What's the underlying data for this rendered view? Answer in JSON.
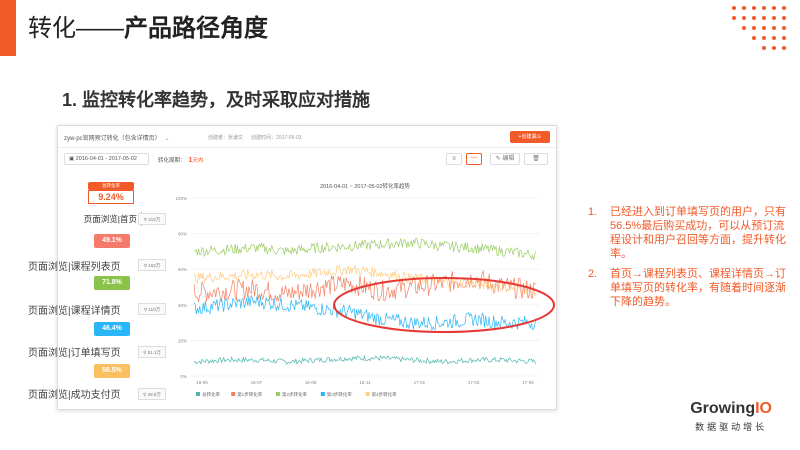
{
  "slide": {
    "title_light": "转化——",
    "title_bold": "产品路径角度",
    "subtitle": "1. 监控转化率趋势，及时采取应对措施",
    "accent_color": "#f15a29"
  },
  "report": {
    "name": "zyw-pc官网预订转化（包含详情页）",
    "creator": "创建者：张谦文",
    "created_at": "创建时间：2017-05-03",
    "new_button": "+创建漏斗",
    "date_range": "2016-04-01 - 2017-05-02",
    "period_label": "转化周期：",
    "period_value": "1",
    "period_unit": "天内",
    "edit_label": "编辑",
    "delete_label": "删除"
  },
  "funnel": {
    "total_tag": "总转化率",
    "total_value": "9.24%",
    "steps": [
      {
        "label": "页面浏览|首页",
        "count": "313万"
      },
      {
        "label": "页面浏览|课程列表页",
        "count": "153万"
      },
      {
        "label": "页面浏览|课程详情页",
        "count": "110万"
      },
      {
        "label": "页面浏览|订单填写页",
        "count": "51.1万"
      },
      {
        "label": "页面浏览|成功支付页",
        "count": "28.9万"
      }
    ],
    "rates": [
      {
        "value": "49.1%",
        "color": "#f47b6b"
      },
      {
        "value": "71.8%",
        "color": "#8bc34a"
      },
      {
        "value": "46.4%",
        "color": "#29b6f6"
      },
      {
        "value": "56.5%",
        "color": "#fbbf5f"
      }
    ]
  },
  "chart_data": {
    "type": "line",
    "title": "2016-04-01 ~ 2017-05-02转化率趋势",
    "x": [
      "16-05",
      "16-07",
      "16-09",
      "16-11",
      "17-01",
      "17-03",
      "17-05"
    ],
    "ylim": [
      0,
      100
    ],
    "yticks": [
      "100%",
      "80%",
      "60%",
      "40%",
      "20%",
      "0%"
    ],
    "series": [
      {
        "name": "总转化率",
        "color": "#4db6ac",
        "values": [
          8,
          9,
          9,
          8,
          9,
          10,
          10,
          9,
          8,
          9,
          9,
          8
        ]
      },
      {
        "name": "第1步转化率",
        "color": "#f48060",
        "values": [
          47,
          48,
          49,
          46,
          50,
          52,
          48,
          50,
          52,
          55,
          50,
          48
        ]
      },
      {
        "name": "第2步转化率",
        "color": "#9ccc65",
        "values": [
          70,
          71,
          72,
          70,
          72,
          73,
          74,
          75,
          73,
          72,
          70,
          68
        ]
      },
      {
        "name": "第3步转化率",
        "color": "#29b6f6",
        "values": [
          38,
          40,
          42,
          40,
          38,
          36,
          32,
          30,
          30,
          32,
          30,
          30
        ]
      },
      {
        "name": "第4步转化率",
        "color": "#ffcc80",
        "values": [
          55,
          56,
          57,
          56,
          58,
          60,
          58,
          55,
          53,
          52,
          50,
          48
        ]
      }
    ],
    "legend_position": "bottom",
    "grid": true
  },
  "notes": [
    {
      "num": "1.",
      "text": "已经进入到订单填写页的用户，只有56.5%最后购买成功，可以从预订流程设计和用户召回等方面，提升转化率。"
    },
    {
      "num": "2.",
      "text": "首页→课程列表页、课程详情页→订单填写页的转化率，有随着时间逐渐下降的趋势。"
    }
  ],
  "logo": {
    "name_main": "Growing",
    "name_accent": "IO",
    "tagline": "数据驱动增长"
  }
}
